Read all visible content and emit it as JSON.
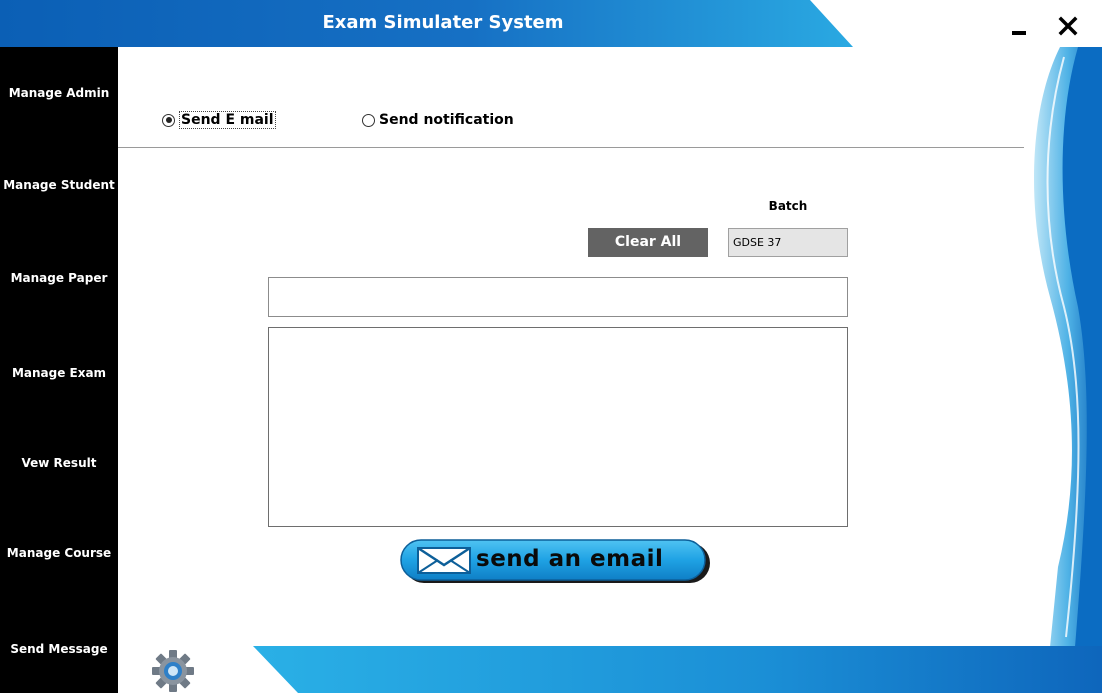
{
  "app": {
    "title": "Exam Simulater System"
  },
  "window_controls": {
    "minimize_icon": "minimize-icon",
    "close_icon": "close-icon"
  },
  "sidebar": {
    "items": [
      {
        "label": "Manage Admin"
      },
      {
        "label": "Manage Student"
      },
      {
        "label": "Manage Paper"
      },
      {
        "label": "Manage Exam"
      },
      {
        "label": "Vew Result"
      },
      {
        "label": "Manage Course"
      },
      {
        "label": "Send Message"
      }
    ]
  },
  "options": {
    "send_email": {
      "label": "Send E mail",
      "checked": true
    },
    "send_notification": {
      "label": "Send notification",
      "checked": false
    }
  },
  "batch": {
    "label": "Batch",
    "value": "GDSE 37"
  },
  "buttons": {
    "clear_all": "Clear All",
    "send_email": "send an email"
  },
  "fields": {
    "subject_value": "",
    "message_value": ""
  },
  "icons": {
    "settings": "gear-icon",
    "envelope": "envelope-icon"
  },
  "colors": {
    "accent_blue": "#1e9fdc",
    "dark_blue": "#0a5fb4",
    "sidebar": "#000000",
    "button_gray": "#636363"
  }
}
